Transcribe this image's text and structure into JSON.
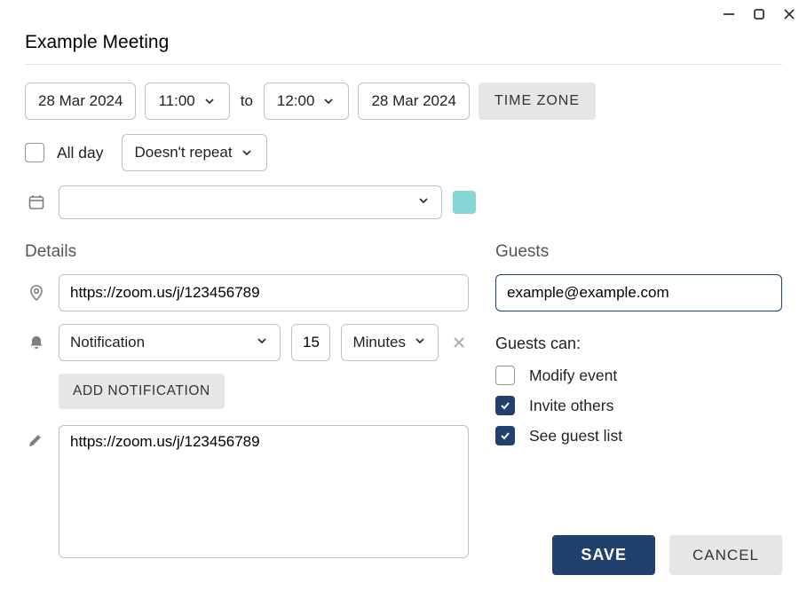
{
  "title": "Example Meeting",
  "dates": {
    "start_date": "28 Mar 2024",
    "start_time": "11:00",
    "to_label": "to",
    "end_time": "12:00",
    "end_date": "28 Mar 2024",
    "timezone_label": "TIME ZONE"
  },
  "options": {
    "all_day_label": "All day",
    "all_day_checked": false,
    "repeat_label": "Doesn't repeat"
  },
  "calendar": {
    "selected": "",
    "color": "#86d6d6"
  },
  "headings": {
    "details": "Details",
    "guests": "Guests",
    "guests_can": "Guests can:"
  },
  "location": "https://zoom.us/j/123456789",
  "notification": {
    "type_label": "Notification",
    "value": "15",
    "unit": "Minutes",
    "add_label": "ADD NOTIFICATION"
  },
  "description": "https://zoom.us/j/123456789",
  "guests": {
    "input": "example@example.com",
    "permissions": {
      "modify": {
        "label": "Modify event",
        "checked": false
      },
      "invite": {
        "label": "Invite others",
        "checked": true
      },
      "see_list": {
        "label": "See guest list",
        "checked": true
      }
    }
  },
  "footer": {
    "save": "SAVE",
    "cancel": "CANCEL"
  }
}
